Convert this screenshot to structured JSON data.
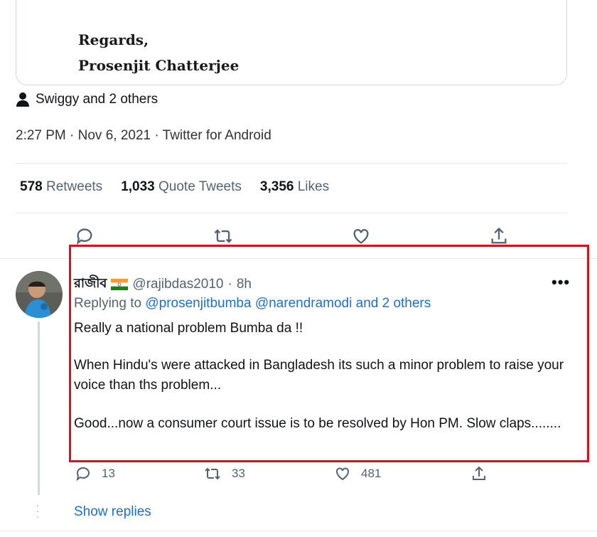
{
  "embedded_card": {
    "regards": "Regards,",
    "signature": "Prosenjit Chatterjee"
  },
  "tagged": {
    "text": "Swiggy and 2 others"
  },
  "timestamp": "2:27 PM · Nov 6, 2021 · Twitter for Android",
  "stats": {
    "retweets_count": "578",
    "retweets_label": "Retweets",
    "quotes_count": "1,033",
    "quotes_label": "Quote Tweets",
    "likes_count": "3,356",
    "likes_label": "Likes"
  },
  "reply": {
    "display_name": "রাজীব",
    "flag": "🇮🇳",
    "handle": "@rajibdas2010",
    "sep": "·",
    "time": "8h",
    "more": "•••",
    "replying_to_prefix": "Replying to",
    "replying_to_users": "@prosenjitbumba @narendramodi and 2 others",
    "paragraph_1": "Really a national problem Bumba da !!",
    "paragraph_2": "When Hindu's were attacked in Bangladesh its such a minor problem to raise your voice than ths problem...",
    "paragraph_3": "Good...now a consumer court issue is to be resolved by Hon PM. Slow claps........",
    "replies": "13",
    "retweets": "33",
    "likes": "481",
    "show_replies": "Show replies"
  },
  "colors": {
    "link": "#1d6fc9",
    "highlight_box": "#d8101c",
    "muted": "#536471"
  }
}
